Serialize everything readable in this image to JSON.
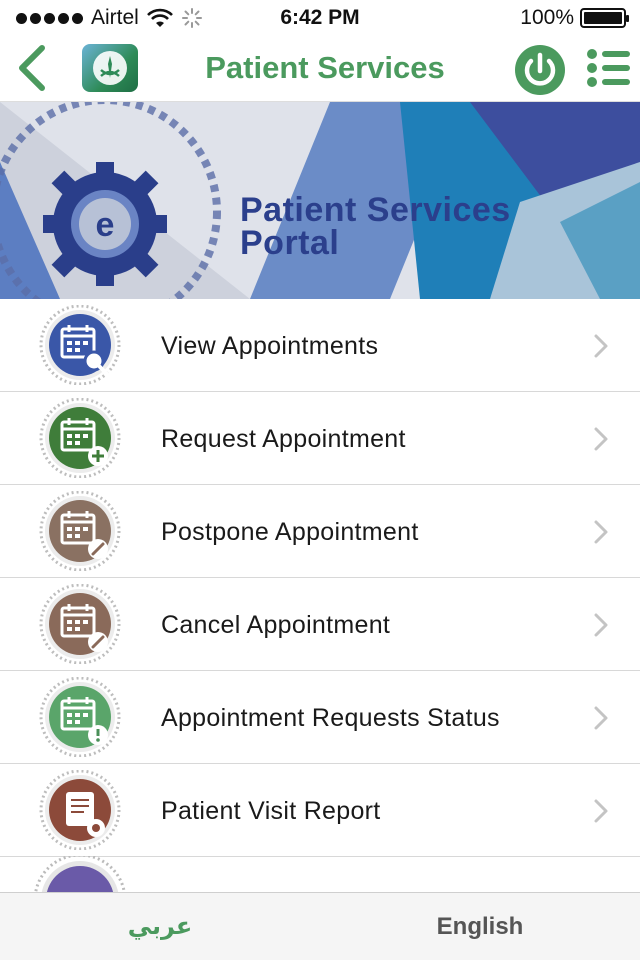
{
  "status_bar": {
    "carrier": "Airtel",
    "time": "6:42 PM",
    "battery_percent": "100%",
    "battery_level": 1.0
  },
  "nav": {
    "title": "Patient Services",
    "back_icon": "chevron-left-icon",
    "power_icon": "power-icon",
    "menu_icon": "list-menu-icon"
  },
  "banner": {
    "line1": "Patient Services",
    "line2": "Portal",
    "gear_letter": "e"
  },
  "items": [
    {
      "label": "View Appointments",
      "color": "#3a57a8",
      "badge": "magnifier"
    },
    {
      "label": "Request Appointment",
      "color": "#3f7d3a",
      "badge": "plus"
    },
    {
      "label": "Postpone Appointment",
      "color": "#8a7162",
      "badge": "pencil"
    },
    {
      "label": "Cancel Appointment",
      "color": "#8a6a5a",
      "badge": "pencil"
    },
    {
      "label": "Appointment Requests Status",
      "color": "#5aa56a",
      "badge": "exclamation"
    },
    {
      "label": "Patient Visit Report",
      "color": "#8c4a3a",
      "badge": "document"
    }
  ],
  "tabs": {
    "arabic": "عربي",
    "english": "English"
  },
  "colors": {
    "brand_green": "#4b9a5e",
    "banner_blue": "#2b3f8c"
  }
}
